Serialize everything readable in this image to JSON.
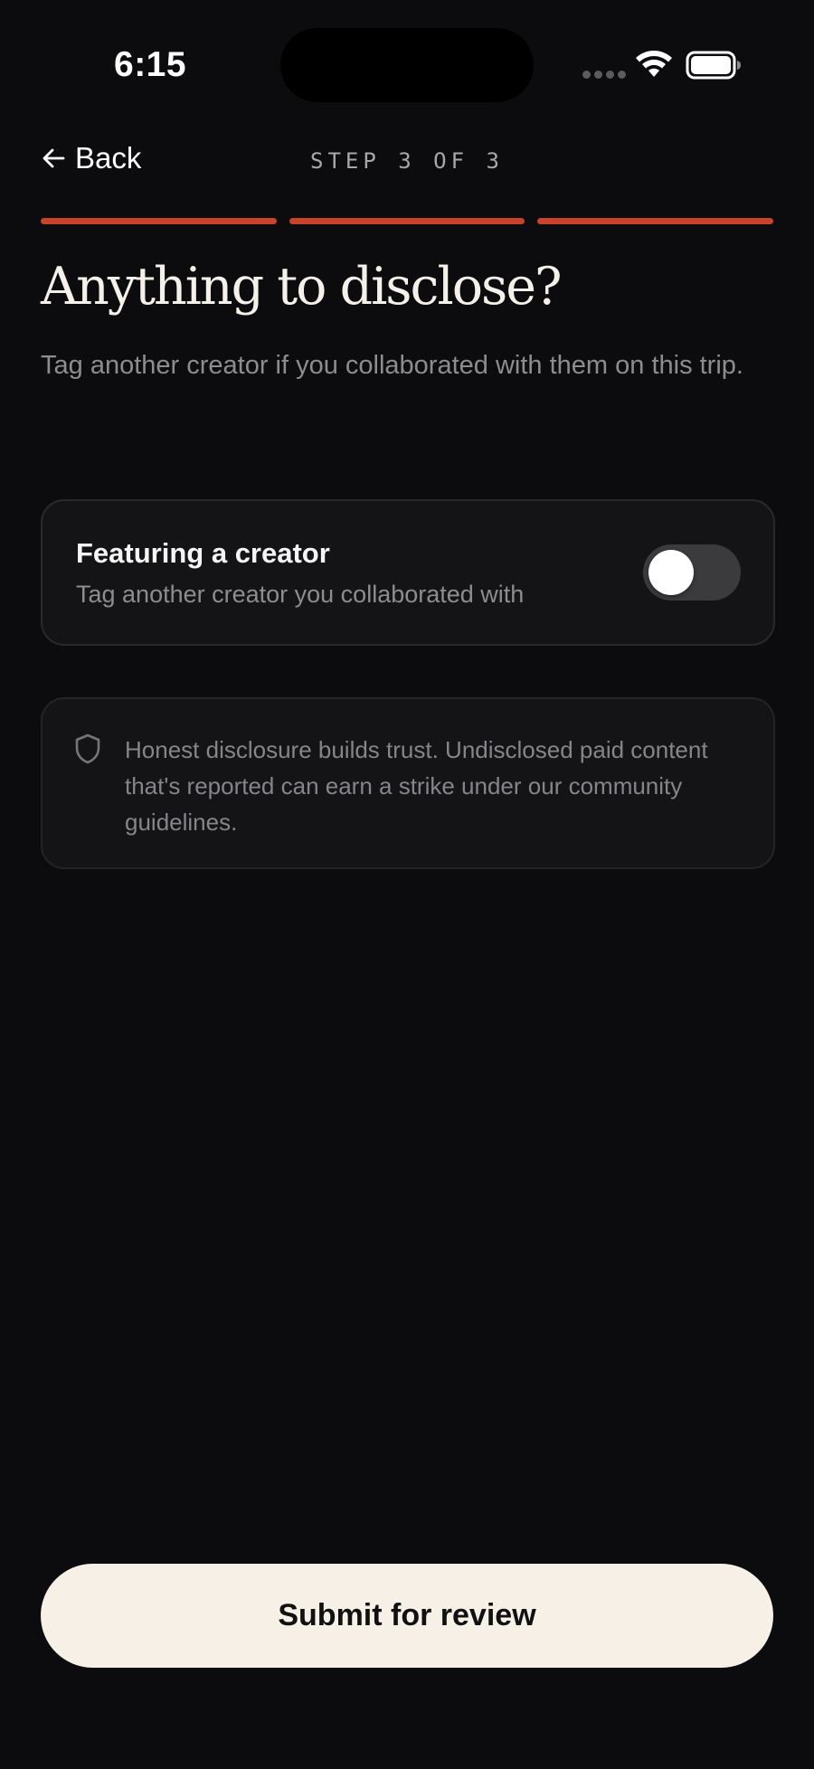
{
  "status_bar": {
    "time": "6:15",
    "icons": [
      "signal-dots-icon",
      "wifi-icon",
      "battery-icon"
    ]
  },
  "nav": {
    "back_label": "Back",
    "back_icon": "arrow-left-icon",
    "step_label": "STEP 3 OF 3"
  },
  "progress": {
    "current_step": 3,
    "total_steps": 3,
    "color": "#c9432b"
  },
  "header": {
    "title": "Anything to disclose?",
    "subtitle": "Tag another creator if you collaborated with them on this trip."
  },
  "creator_toggle": {
    "title": "Featuring a creator",
    "description": "Tag another creator you collaborated with",
    "enabled": false
  },
  "notice": {
    "icon": "shield-icon",
    "text": "Honest disclosure builds trust. Undisclosed paid content that's reported can earn a strike under our community guidelines."
  },
  "footer": {
    "submit_label": "Submit for review"
  },
  "colors": {
    "background": "#0c0c0e",
    "accent": "#c9432b",
    "card": "#141416",
    "button": "#f6f0e6"
  }
}
